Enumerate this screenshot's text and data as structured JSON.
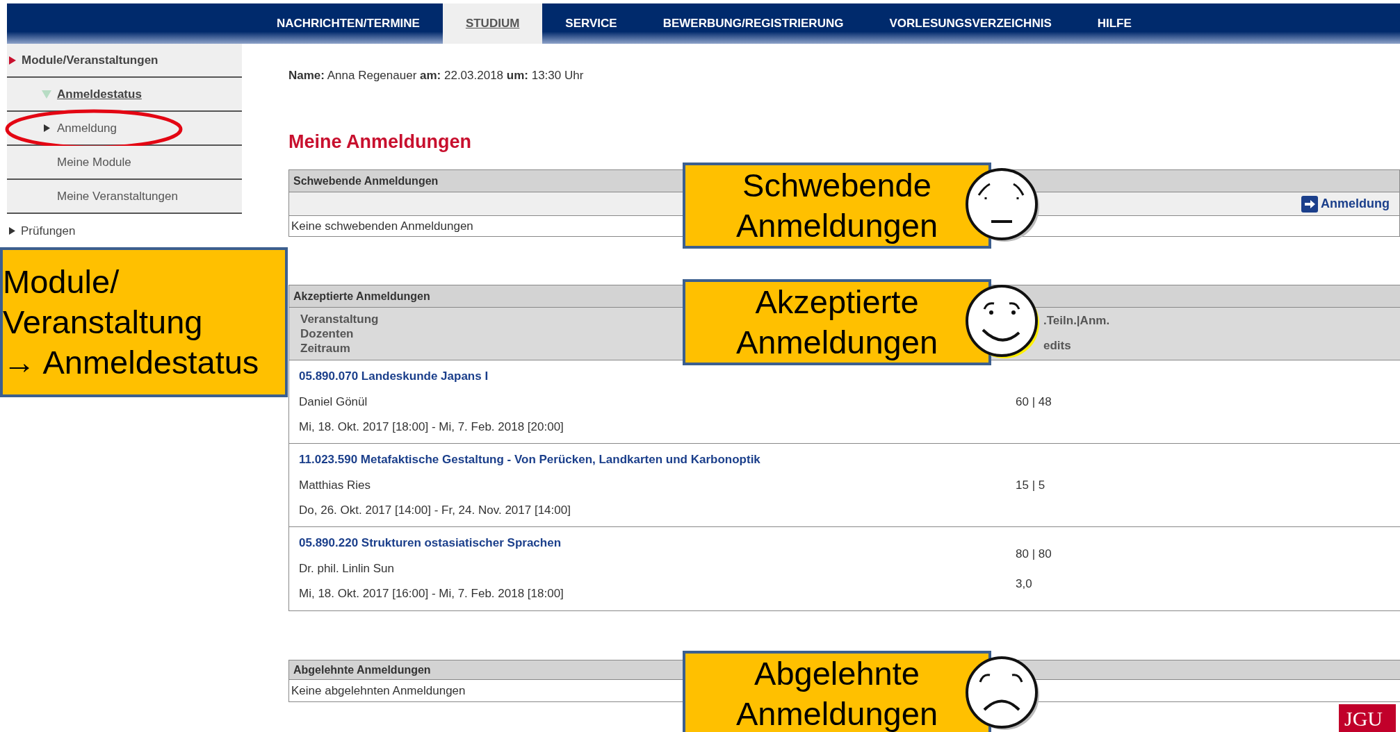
{
  "nav": {
    "items": [
      {
        "label": "NACHRICHTEN/TERMINE",
        "selected": false
      },
      {
        "label": "STUDIUM",
        "selected": true
      },
      {
        "label": "SERVICE",
        "selected": false
      },
      {
        "label": "BEWERBUNG/REGISTRIERUNG",
        "selected": false
      },
      {
        "label": "VORLESUNGSVERZEICHNIS",
        "selected": false
      },
      {
        "label": "HILFE",
        "selected": false
      }
    ]
  },
  "sidebar": {
    "items": [
      {
        "label": "Module/Veranstaltungen",
        "kind": "active",
        "selected": false,
        "children": [
          {
            "label": "Anmeldestatus",
            "kind": "open",
            "selected": true
          },
          {
            "label": "Anmeldung",
            "kind": "closed",
            "selected": false,
            "highlighted": true
          },
          {
            "label": "Meine Module",
            "kind": "plain",
            "selected": false
          },
          {
            "label": "Meine Veranstaltungen",
            "kind": "plain",
            "selected": false
          }
        ]
      },
      {
        "label": "Prüfungen",
        "kind": "closed",
        "selected": false
      }
    ]
  },
  "info": {
    "text": "**Name:** Anna Regenauer **am:** 22.03.2018 **um:** 13:30 Uhr"
  },
  "heading": "Meine Anmeldungen",
  "pending": {
    "title": "Schwebende Anmeldungen",
    "action": "Anmeldung",
    "empty": "Keine schwebenden Anmeldungen"
  },
  "accepted": {
    "title": "Akzeptierte Anmeldungen",
    "columns": [
      [
        "Veranstaltung",
        "Dozenten",
        "Zeitraum"
      ],
      [
        ".Teiln.|Anm.",
        "edits"
      ]
    ],
    "rows": [
      {
        "course": "05.890.070 Landeskunde Japans I",
        "lecturer": "Daniel Gönül",
        "period": "Mi, 18. Okt. 2017 [18:00] - Mi, 7. Feb. 2018 [20:00]",
        "seats": "60 | 48"
      },
      {
        "course": "11.023.590 Metafaktische Gestaltung - Von Perücken, Landkarten und Karbonoptik",
        "lecturer": "Matthias Ries",
        "period": "Do, 26. Okt. 2017 [14:00] - Fr, 24. Nov. 2017 [14:00]",
        "seats": "15 | 5"
      },
      {
        "course": "05.890.220 Strukturen ostasiatischer Sprachen",
        "lecturer": "Dr. phil. Linlin Sun",
        "period": "Mi, 18. Okt. 2017 [16:00] - Mi, 7. Feb. 2018 [18:00]",
        "seats": "80 | 80",
        "credits": "3,0"
      }
    ]
  },
  "rejected": {
    "title": "Abgelehnte Anmeldungen",
    "empty": "Keine abgelehnten Anmeldungen"
  },
  "callouts": [
    {
      "lines": [
        "Module/",
        "Veranstaltung",
        "→ Anmeldestatus"
      ],
      "kind": "plain"
    },
    {
      "lines": [
        "Schwebende",
        "Anmeldungen"
      ],
      "kind": "worried"
    },
    {
      "lines": [
        "Akzeptierte",
        "Anmeldungen"
      ],
      "kind": "happy"
    },
    {
      "lines": [
        "Abgelehnte",
        "Anmeldungen"
      ],
      "kind": "sad"
    }
  ],
  "logo": "JGU"
}
